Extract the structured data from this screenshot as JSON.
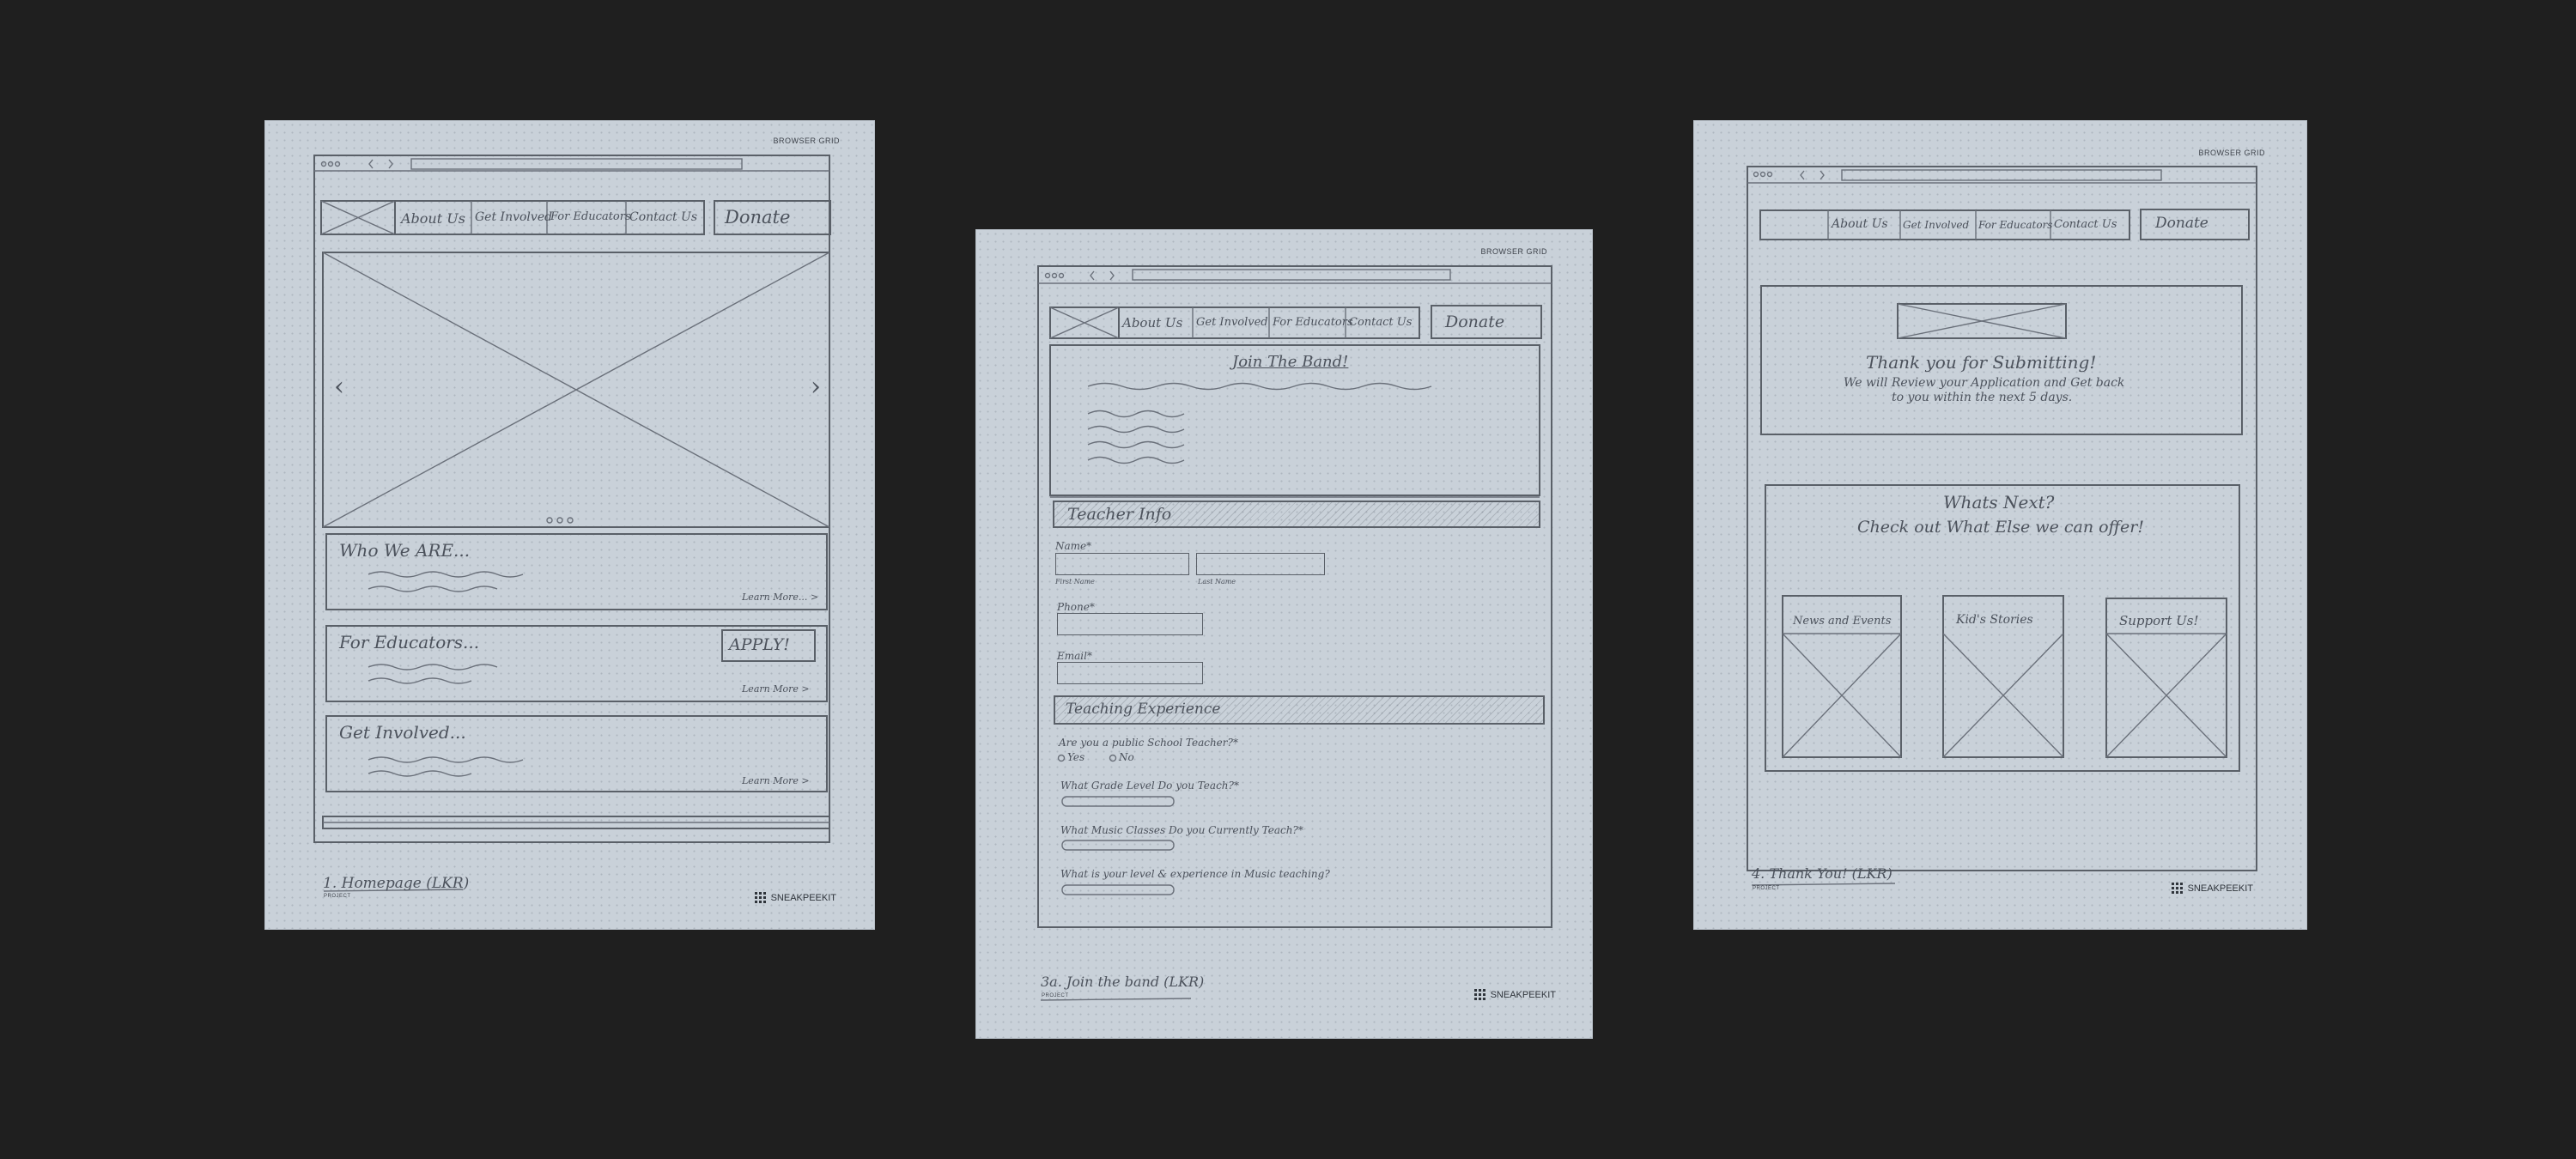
{
  "sheets": {
    "homepage": {
      "corner": "BROWSER GRID",
      "nav": [
        "About Us",
        "Get Involved",
        "For Educators",
        "Contact Us"
      ],
      "donate": "Donate",
      "carousel_prev": "‹",
      "carousel_next": "›",
      "sections": [
        {
          "heading": "Who We ARE...",
          "link": "Learn More... >"
        },
        {
          "heading": "For Educators...",
          "button": "APPLY!",
          "link": "Learn More >"
        },
        {
          "heading": "Get Involved...",
          "link": "Learn More >"
        }
      ],
      "footer_title": "1. Homepage (LKR)",
      "footer_sub": "PROJECT",
      "brand": "SNEAKPEEKIT"
    },
    "join": {
      "corner": "BROWSER GRID",
      "nav": [
        "About Us",
        "Get Involved",
        "For Educators",
        "Contact Us"
      ],
      "donate": "Donate",
      "hero_title": "Join The Band!",
      "teacher_info": "Teacher Info",
      "name_label": "Name*",
      "first_name": "First Name",
      "last_name": "Last Name",
      "phone_label": "Phone*",
      "email_label": "Email*",
      "teaching_experience": "Teaching Experience",
      "q1": "Are you a public School Teacher?*",
      "q1_yes": "Yes",
      "q1_no": "No",
      "q2": "What Grade Level Do you Teach?*",
      "q3": "What Music Classes Do you Currently Teach?*",
      "q4": "What is your level & experience in Music teaching?",
      "footer_title": "3a. Join the band (LKR)",
      "footer_sub": "PROJECT",
      "brand": "SNEAKPEEKIT"
    },
    "thanks": {
      "corner": "BROWSER GRID",
      "nav": [
        "About Us",
        "Get Involved",
        "For Educators",
        "Contact Us"
      ],
      "donate": "Donate",
      "thanks_title": "Thank you for Submitting!",
      "thanks_line1": "We will Review your Application and Get back",
      "thanks_line2": "to you within the next 5 days.",
      "next_title": "Whats Next?",
      "next_sub": "Check out What Else we can offer!",
      "cards": [
        "News and Events",
        "Kid's Stories",
        "Support Us!"
      ],
      "footer_title": "4. Thank You! (LKR)",
      "footer_sub": "PROJECT",
      "brand": "SNEAKPEEKIT"
    }
  },
  "colors": {
    "background": "#1f1f1f",
    "paper": "#c9d1d9",
    "pencil": "#5a6068"
  }
}
